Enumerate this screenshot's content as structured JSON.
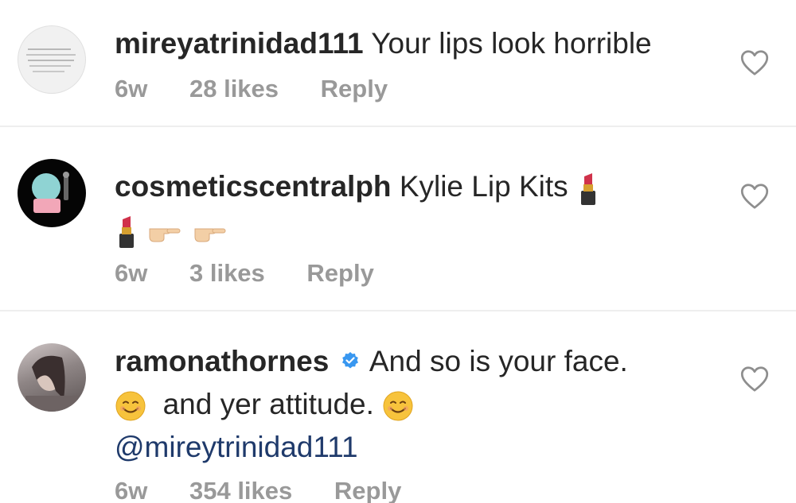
{
  "comments": [
    {
      "username": "mireyatrinidad111",
      "text": "Your lips look horrible",
      "time": "6w",
      "likes": "28 likes",
      "reply": "Reply"
    },
    {
      "username": "cosmeticscentralph",
      "text": "Kylie Lip Kits",
      "time": "6w",
      "likes": "3 likes",
      "reply": "Reply"
    },
    {
      "username": "ramonathornes",
      "text": "And so is your face.",
      "text2": "and yer attitude.",
      "mention": "@mireytrinidad111",
      "time": "6w",
      "likes": "354 likes",
      "reply": "Reply",
      "verified": true
    }
  ],
  "icons": {
    "like": "heart-outline-icon",
    "verified": "verified-badge-icon",
    "lipstick": "lipstick-emoji",
    "pointing": "pointing-hand-emoji",
    "smile": "smiling-face-emoji"
  },
  "colors": {
    "text": "#262626",
    "meta": "#999999",
    "mention": "#1f3a6b",
    "verified": "#3897f0",
    "divider": "#eeeeee"
  }
}
